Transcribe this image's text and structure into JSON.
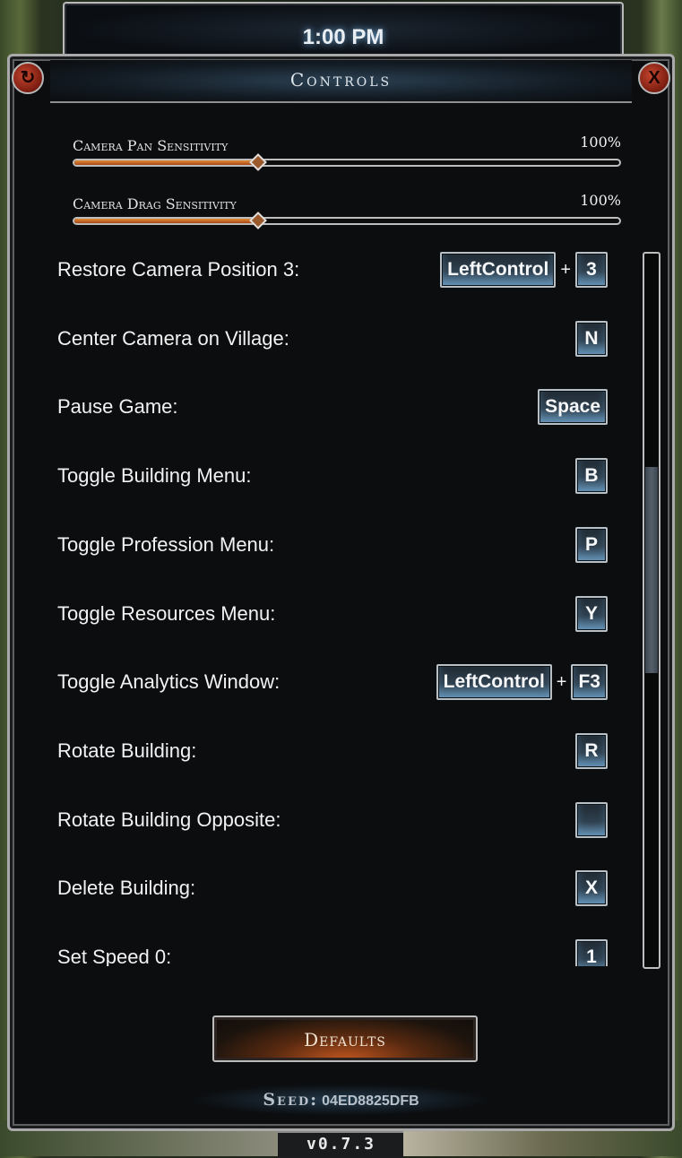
{
  "header": {
    "time": "1:00 PM"
  },
  "panel": {
    "title": "Controls",
    "undo_icon": "↻",
    "close_label": "X"
  },
  "sliders": [
    {
      "label": "Camera Pan Sensitivity",
      "value_text": "100%",
      "fraction": 0.338
    },
    {
      "label": "Camera Drag Sensitivity",
      "value_text": "100%",
      "fraction": 0.338
    }
  ],
  "bindings": [
    {
      "label": "Restore Camera Position 3:",
      "keys": [
        "LeftControl",
        "3"
      ]
    },
    {
      "label": "Center Camera on Village:",
      "keys": [
        "N"
      ]
    },
    {
      "label": "Pause Game:",
      "keys": [
        "Space"
      ]
    },
    {
      "label": "Toggle Building Menu:",
      "keys": [
        "B"
      ]
    },
    {
      "label": "Toggle Profession Menu:",
      "keys": [
        "P"
      ]
    },
    {
      "label": "Toggle Resources Menu:",
      "keys": [
        "Y"
      ]
    },
    {
      "label": "Toggle Analytics Window:",
      "keys": [
        "LeftControl",
        "F3"
      ]
    },
    {
      "label": "Rotate Building:",
      "keys": [
        "R"
      ]
    },
    {
      "label": "Rotate Building Opposite:",
      "keys": [
        ""
      ]
    },
    {
      "label": "Delete Building:",
      "keys": [
        "X"
      ]
    },
    {
      "label": "Set Speed 0:",
      "keys": [
        "1"
      ]
    }
  ],
  "plus_sign": "+",
  "scrollbar": {
    "position_fraction": 0.42
  },
  "defaults_button": {
    "label": "Defaults"
  },
  "seed": {
    "label": "Seed:",
    "value": "04ED8825DFB"
  },
  "version": "v0.7.3",
  "colors": {
    "accent_orange": "#d9782c",
    "key_blue": "#5c84a1",
    "close_red": "#c4462e"
  }
}
